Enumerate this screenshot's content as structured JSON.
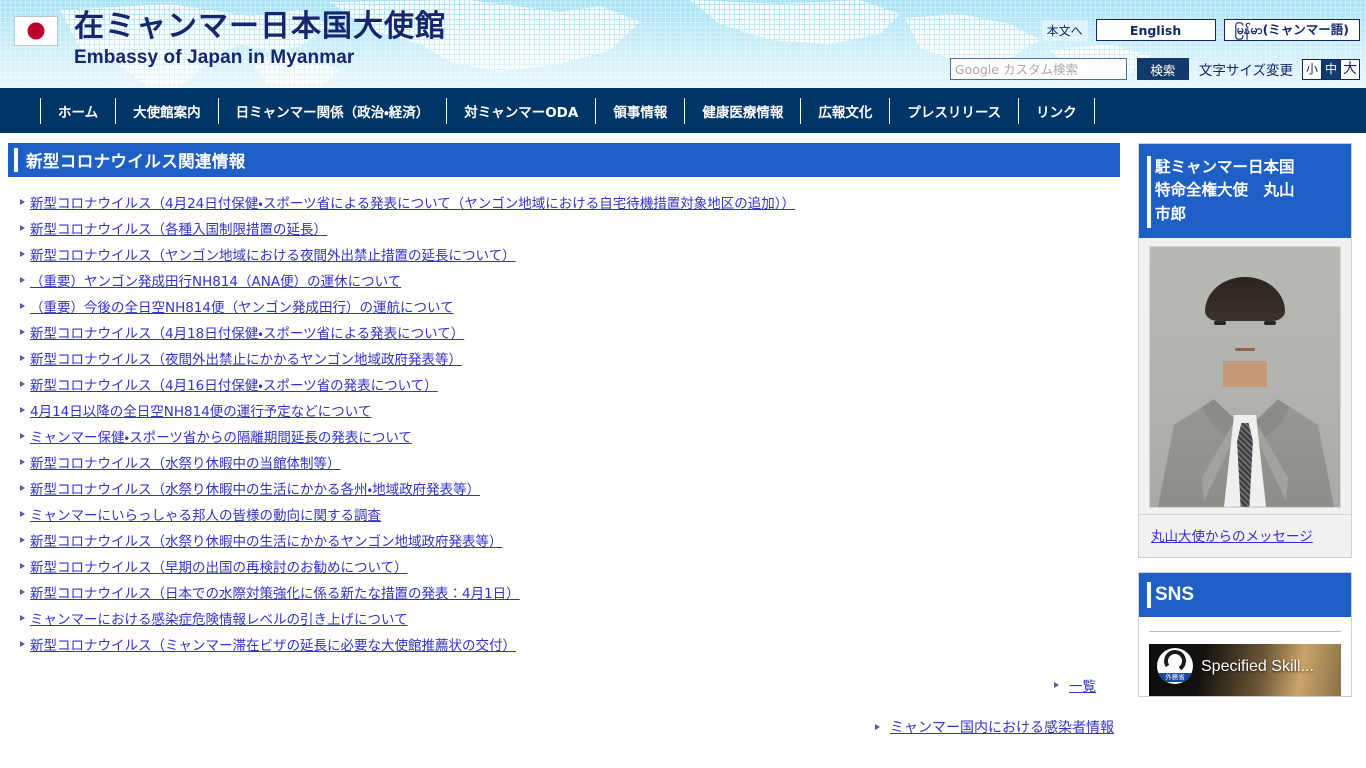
{
  "header": {
    "flag_icon": "japan-flag-icon",
    "title_ja": "在ミャンマー日本国大使館",
    "title_en": "Embassy of Japan in Myanmar",
    "skip_link": "本文へ",
    "lang_english": "English",
    "lang_myanmar": "မြန်မာ(ミャンマー語)",
    "lang_myanmar_overlay_a": "မြန်",
    "lang_myanmar_overlay_b": "မာ",
    "search": {
      "placeholder": "Google カスタム検索",
      "value": "",
      "button_label": "検索"
    },
    "fontsize": {
      "label": "文字サイズ変更",
      "options": [
        "小",
        "中",
        "大"
      ],
      "selected": "中"
    }
  },
  "nav": {
    "items": [
      {
        "label": "ホーム"
      },
      {
        "label": "大使館案内"
      },
      {
        "label": "日ミャンマー関係（政治・経済）"
      },
      {
        "label": "対ミャンマーODA"
      },
      {
        "label": "領事情報"
      },
      {
        "label": "健康医療情報"
      },
      {
        "label": "広報文化"
      },
      {
        "label": "プレスリリース"
      },
      {
        "label": "リンク"
      }
    ]
  },
  "main": {
    "section_title": "新型コロナウイルス関連情報",
    "links": [
      "新型コロナウイルス（4月24日付保健・スポーツ省による発表について（ヤンゴン地域における自宅待機措置対象地区の追加））",
      "新型コロナウイルス（各種入国制限措置の延長）",
      "新型コロナウイルス（ヤンゴン地域における夜間外出禁止措置の延長について）",
      "（重要）ヤンゴン発成田行NH814（ANA便）の運休について",
      "（重要）今後の全日空NH814便（ヤンゴン発成田行）の運航について",
      "新型コロナウイルス（4月18日付保健・スポーツ省による発表について）",
      "新型コロナウイルス（夜間外出禁止にかかるヤンゴン地域政府発表等）",
      "新型コロナウイルス（4月16日付保健・スポーツ省の発表について）",
      "4月14日以降の全日空NH814便の運行予定などについて",
      "ミャンマー保健・スポーツ省からの隔離期間延長の発表について",
      "新型コロナウイルス（水祭り休暇中の当館体制等）",
      "新型コロナウイルス（水祭り休暇中の生活にかかる各州・地域政府発表等）",
      "ミャンマーにいらっしゃる邦人の皆様の動向に関する調査",
      "新型コロナウイルス（水祭り休暇中の生活にかかるヤンゴン地域政府発表等）",
      "新型コロナウイルス（早期の出国の再検討のお勧めについて）",
      "新型コロナウイルス（日本での水際対策強化に係る新たな措置の発表：4月1日）",
      "ミャンマーにおける感染症危険情報レベルの引き上げについて",
      "新型コロナウイルス（ミャンマー滞在ビザの延長に必要な大使館推薦状の交付）"
    ],
    "more_label": "一覧",
    "infection_info_label": "ミャンマー国内における感染者情報"
  },
  "sidebar": {
    "ambassador": {
      "title": "駐ミャンマー日本国\n特命全権大使　丸山\n市郎",
      "photo_alt": "ambassador-portrait",
      "message_link": "丸山大使からのメッセージ"
    },
    "sns": {
      "title": "SNS",
      "video_caption": "Specified Skill...",
      "badge_text": "外務省"
    }
  },
  "colors": {
    "nav_bg": "#003568",
    "section_head_bg": "#1e5fc6",
    "link_color": "#3333cc",
    "brand_text": "#15256e",
    "search_button_bg": "#123a6b",
    "flag_red": "#bc002d"
  }
}
